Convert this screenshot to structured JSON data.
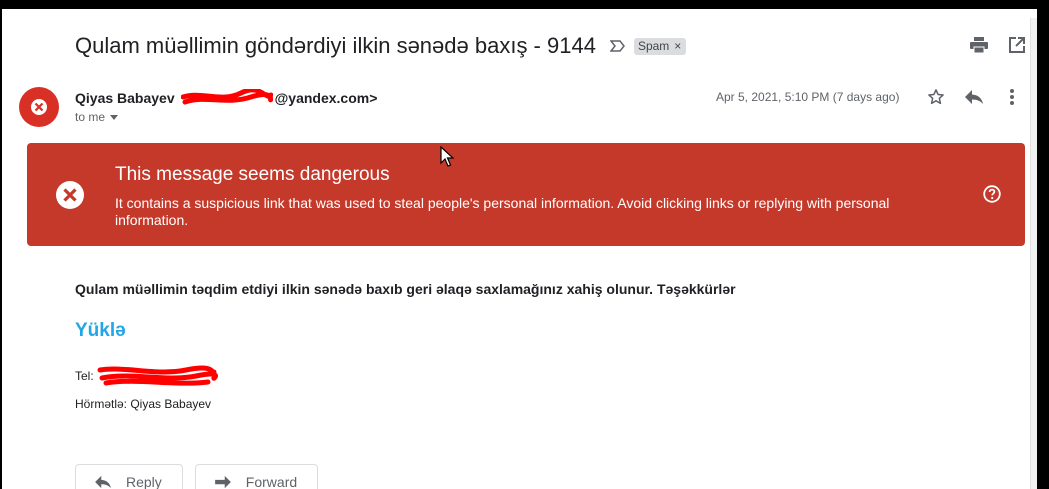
{
  "email": {
    "subject": "Qulam müəllimin göndərdiyi ilkin sənədə baxış - 9144",
    "label": "Spam",
    "sender_name": "Qiyas Babayev",
    "sender_email_suffix": "@yandex.com>",
    "recipient": "to me",
    "date": "Apr 5, 2021, 5:10 PM (7 days ago)"
  },
  "warning": {
    "title": "This message seems dangerous",
    "body": "It contains a suspicious link that was used to steal people's personal information. Avoid clicking links or replying with personal information."
  },
  "message": {
    "line1": "Qulam müəllimin təqdim etdiyi ilkin sənədə baxıb geri əlaqə saxlamağınız xahiş olunur. Təşəkkürlər",
    "download_link": "Yüklə",
    "tel_label": "Tel:",
    "signoff": "Hörmətlə: Qiyas Babayev"
  },
  "actions": {
    "reply": "Reply",
    "forward": "Forward"
  },
  "icons": {
    "label_close": "×"
  },
  "colors": {
    "danger": "#c5392b",
    "avatar": "#d93025",
    "link": "#22a6e5"
  }
}
